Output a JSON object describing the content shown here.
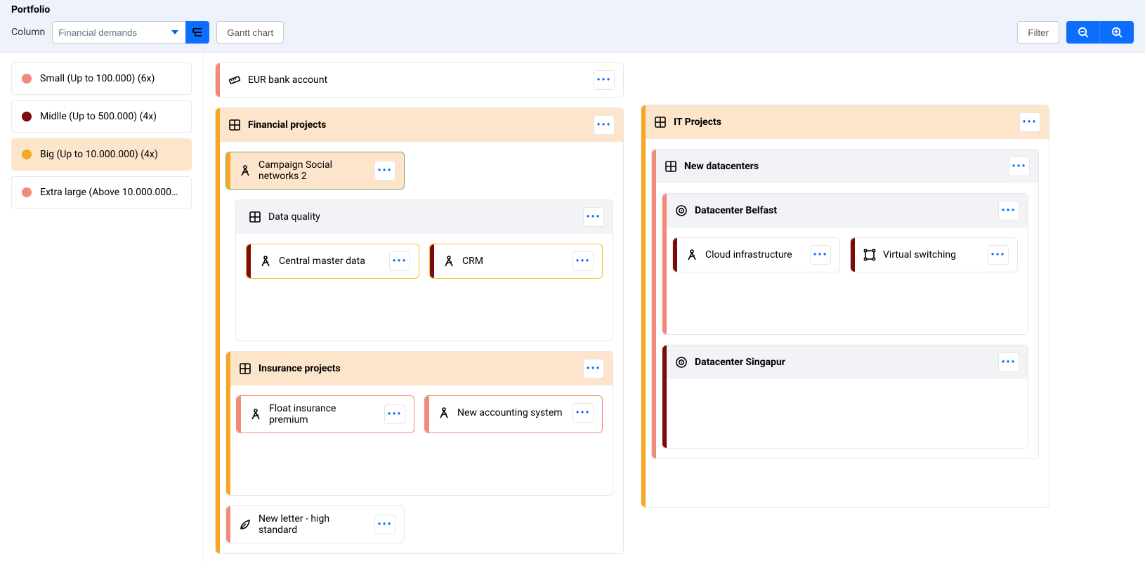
{
  "header": {
    "title": "Portfolio",
    "column_label": "Column",
    "column_select_value": "Financial demands",
    "gantt_button": "Gantt chart",
    "filter_button": "Filter"
  },
  "colors": {
    "small": "#f08b7a",
    "midlle": "#7a0c0c",
    "big": "#f5a623",
    "extra_large": "#f08b7a",
    "accent_blue": "#0d6efd"
  },
  "legend": {
    "items": [
      {
        "label": "Small (Up to 100.000) (6x)",
        "color": "#f08b7a",
        "active": false
      },
      {
        "label": "Midlle (Up to 500.000) (4x)",
        "color": "#7a0c0c",
        "active": false
      },
      {
        "label": "Big (Up to 10.000.000) (4x)",
        "color": "#f5a623",
        "active": true
      },
      {
        "label": "Extra large (Above 10.000.000) (…",
        "color": "#f08b7a",
        "active": false
      }
    ]
  },
  "board": {
    "col0": {
      "eur_bank_account": {
        "name": "EUR bank account",
        "accent": "#f08b7a",
        "icon": "ruler"
      },
      "financial_projects": {
        "name": "Financial projects",
        "accent": "#f5a623",
        "icon": "grid",
        "campaign_social_networks_2": {
          "name": "Campaign Social networks 2",
          "accent": "#f5a623",
          "icon": "compass-draw"
        },
        "data_quality": {
          "name": "Data quality",
          "accent": "#f5a623",
          "icon": "grid",
          "central_master_data": {
            "name": "Central master data",
            "accent": "#7a0c0c",
            "icon": "compass-draw"
          },
          "crm": {
            "name": "CRM",
            "accent": "#7a0c0c",
            "icon": "compass-draw"
          }
        },
        "insurance_projects": {
          "name": "Insurance projects",
          "accent": "#f5a623",
          "icon": "grid",
          "float_insurance_premium": {
            "name": "Float insurance premium",
            "accent": "#f08b7a",
            "icon": "compass-draw"
          },
          "new_accounting_system": {
            "name": "New accounting system",
            "accent": "#f08b7a",
            "icon": "compass-draw"
          }
        },
        "new_letter_high_standard": {
          "name": "New letter - high standard",
          "accent": "#f08b7a",
          "icon": "leaf"
        }
      }
    },
    "col1": {
      "it_projects": {
        "name": "IT Projects",
        "accent": "#f5a623",
        "icon": "grid",
        "new_datacenters": {
          "name": "New datacenters",
          "accent": "#f08b7a",
          "icon": "grid",
          "datacenter_belfast": {
            "name": "Datacenter Belfast",
            "accent": "#f08b7a",
            "icon": "target",
            "cloud_infrastructure": {
              "name": "Cloud infrastructure",
              "accent": "#7a0c0c",
              "icon": "compass-draw"
            },
            "virtual_switching": {
              "name": "Virtual switching",
              "accent": "#7a0c0c",
              "icon": "shape"
            }
          },
          "datacenter_singapur": {
            "name": "Datacenter Singapur",
            "accent": "#7a0c0c",
            "icon": "target"
          }
        }
      }
    }
  }
}
